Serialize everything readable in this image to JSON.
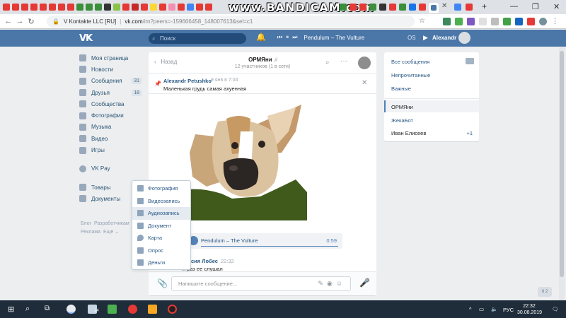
{
  "browser": {
    "watermark": "www.BANDICAM.com",
    "address": {
      "site_label": "V Kontakte LLC [RU]",
      "host": "vk.com",
      "path": "/im?peers=-159666458_148007613&sel=c1"
    },
    "colors": {
      "tabstrip": "#dee1e6",
      "toolbar": "#ffffff"
    }
  },
  "vk_header": {
    "logo": "VK",
    "search_placeholder": "Поиск",
    "now_playing": "Pendulum – The Vulture",
    "os_label": "OS",
    "user_name": "Alexandr",
    "color": "#4a76a8"
  },
  "left_menu": {
    "items": [
      {
        "label": "Моя страница",
        "icon": "home-icon"
      },
      {
        "label": "Новости",
        "icon": "news-icon"
      },
      {
        "label": "Сообщения",
        "icon": "messages-icon",
        "count": "31"
      },
      {
        "label": "Друзья",
        "icon": "friends-icon",
        "count": "18"
      },
      {
        "label": "Сообщества",
        "icon": "groups-icon"
      },
      {
        "label": "Фотографии",
        "icon": "camera-icon"
      },
      {
        "label": "Музыка",
        "icon": "music-icon"
      },
      {
        "label": "Видео",
        "icon": "video-icon"
      },
      {
        "label": "Игры",
        "icon": "games-icon"
      }
    ],
    "vkpay": "VK Pay",
    "items2": [
      {
        "label": "Товары",
        "icon": "goods-icon"
      },
      {
        "label": "Документы",
        "icon": "docs-icon"
      }
    ],
    "footer": {
      "blog": "Блог",
      "developers": "Разработчикам",
      "ads": "Реклама",
      "more": "Ещё"
    }
  },
  "chat": {
    "back": "Назад",
    "title": "ОРМЯни",
    "subtitle": "12 участников (1 в сети)",
    "pinned": {
      "author": "Alexandr Petushko",
      "time": "9 янв в 7:04",
      "text": "Маленькая грудь самая ахуенная"
    },
    "audio": {
      "artist": "Pendulum",
      "dash": "–",
      "title": "The Vulture",
      "duration": "0:59"
    },
    "message2": {
      "author": "стасия Лобес",
      "time": "22:32",
      "text": "я раз ее слушал"
    },
    "composer_placeholder": "Напишите сообщение..."
  },
  "attach_menu": {
    "items": [
      {
        "label": "Фотография",
        "icon": "photo-icon"
      },
      {
        "label": "Видеозапись",
        "icon": "video-icon"
      },
      {
        "label": "Аудиозапись",
        "icon": "audio-icon"
      },
      {
        "label": "Документ",
        "icon": "document-icon"
      },
      {
        "label": "Карта",
        "icon": "map-pin-icon"
      },
      {
        "label": "Опрос",
        "icon": "poll-icon"
      },
      {
        "label": "Деньги",
        "icon": "money-icon"
      }
    ],
    "hovered_index": 2
  },
  "right_panel": {
    "filters": [
      "Все сообщения",
      "Непрочитанные",
      "Важные"
    ],
    "chats": [
      {
        "label": "ОРМЯни",
        "active": true
      },
      {
        "label": "ЖекаБот"
      },
      {
        "label": "Иван Елисеев",
        "badge": "+1"
      }
    ]
  },
  "corner_badge": "6 2",
  "taskbar": {
    "language": "РУС",
    "time": "22:32",
    "date": "30.08.2019",
    "notification_count": "14"
  }
}
